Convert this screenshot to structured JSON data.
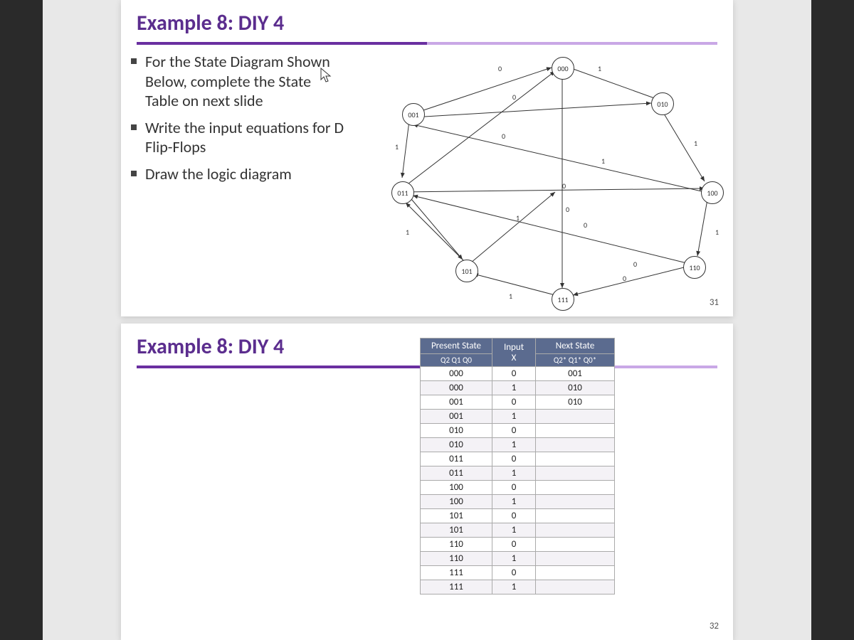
{
  "slide1": {
    "title": "Example 8: DIY 4",
    "bullets": [
      "For the State Diagram Shown Below, complete the State Table on next slide",
      "Write the input equations for D Flip-Flops",
      "Draw the logic diagram"
    ],
    "page_num": "31",
    "diagram": {
      "nodes": [
        "000",
        "001",
        "010",
        "011",
        "100",
        "101",
        "110",
        "111"
      ],
      "edge_labels": [
        "0",
        "1",
        "0",
        "1",
        "0",
        "1",
        "0",
        "1",
        "0",
        "0",
        "0",
        "1",
        "1"
      ]
    }
  },
  "slide2": {
    "title": "Example 8: DIY 4",
    "page_num": "32",
    "table": {
      "headers": {
        "present_top": "Present State",
        "present_sub": "Q2 Q1 Q0",
        "input_top": "Input",
        "input_sub": "X",
        "next_top": "Next State",
        "next_sub": "Q2* Q1* Q0*"
      },
      "rows": [
        {
          "ps": "000",
          "x": "0",
          "ns": "001"
        },
        {
          "ps": "000",
          "x": "1",
          "ns": "010"
        },
        {
          "ps": "001",
          "x": "0",
          "ns": "010"
        },
        {
          "ps": "001",
          "x": "1",
          "ns": ""
        },
        {
          "ps": "010",
          "x": "0",
          "ns": ""
        },
        {
          "ps": "010",
          "x": "1",
          "ns": ""
        },
        {
          "ps": "011",
          "x": "0",
          "ns": ""
        },
        {
          "ps": "011",
          "x": "1",
          "ns": ""
        },
        {
          "ps": "100",
          "x": "0",
          "ns": ""
        },
        {
          "ps": "100",
          "x": "1",
          "ns": ""
        },
        {
          "ps": "101",
          "x": "0",
          "ns": ""
        },
        {
          "ps": "101",
          "x": "1",
          "ns": ""
        },
        {
          "ps": "110",
          "x": "0",
          "ns": ""
        },
        {
          "ps": "110",
          "x": "1",
          "ns": ""
        },
        {
          "ps": "111",
          "x": "0",
          "ns": ""
        },
        {
          "ps": "111",
          "x": "1",
          "ns": ""
        }
      ]
    }
  }
}
